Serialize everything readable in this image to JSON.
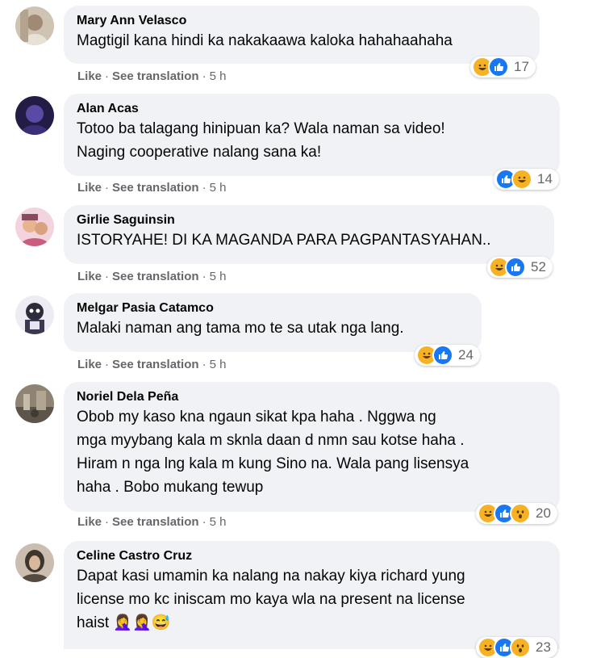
{
  "actions": {
    "like": "Like",
    "see_translation": "See translation",
    "separator": "·"
  },
  "comments": [
    {
      "author": "Mary Ann Velasco",
      "lines": [
        "Magtigil kana hindi ka nakakaawa kaloka hahahaahaha"
      ],
      "time": "5 h",
      "reactions": [
        "haha",
        "like"
      ],
      "count": "17",
      "avatar_colors": [
        "#c7b9a8",
        "#8e7d6b"
      ]
    },
    {
      "author": "Alan Acas",
      "lines": [
        "Totoo ba talagang hinipuan ka? Wala naman sa video!",
        "Naging cooperative nalang sana ka!"
      ],
      "time": "5 h",
      "reactions": [
        "like",
        "haha"
      ],
      "count": "14",
      "avatar_colors": [
        "#6a5ba8",
        "#1d1838"
      ]
    },
    {
      "author": "Girlie Saguinsin",
      "lines": [
        "ISTORYAHE! DI KA MAGANDA PARA PAGPANTASYAHAN.."
      ],
      "time": "5 h",
      "reactions": [
        "haha",
        "like"
      ],
      "count": "52",
      "avatar_colors": [
        "#f1c6d4",
        "#a8566e"
      ]
    },
    {
      "author": "Melgar Pasia Catamco",
      "lines": [
        "Malaki naman ang tama mo te sa utak nga lang."
      ],
      "time": "5 h",
      "reactions": [
        "haha",
        "like"
      ],
      "count": "24",
      "avatar_colors": [
        "#dcdde6",
        "#2c2b39"
      ]
    },
    {
      "author": "Noriel Dela Peña",
      "lines": [
        "Obob my kaso kna ngaun sikat kpa haha . Nggwa ng",
        "mga myybang kala m sknla daan d nmn sau kotse haha .",
        "Hiram n nga lng kala m kung Sino na. Wala pang lisensya",
        "haha . Bobo mukang tewup"
      ],
      "time": "5 h",
      "reactions": [
        "haha",
        "like",
        "wow"
      ],
      "count": "20",
      "avatar_colors": [
        "#9a8d7c",
        "#4d463d"
      ]
    },
    {
      "author": "Celine Castro Cruz",
      "lines": [
        "Dapat kasi umamin ka nalang na nakay kiya richard yung",
        "license mo kc iniscam mo kaya wla na present na license",
        "haist"
      ],
      "emoji": [
        "🤦‍♀️",
        "🤦‍♀️",
        "😅"
      ],
      "time": "",
      "reactions": [
        "haha",
        "like",
        "wow"
      ],
      "count": "23",
      "avatar_colors": [
        "#b9a99a",
        "#3e352d"
      ]
    }
  ]
}
